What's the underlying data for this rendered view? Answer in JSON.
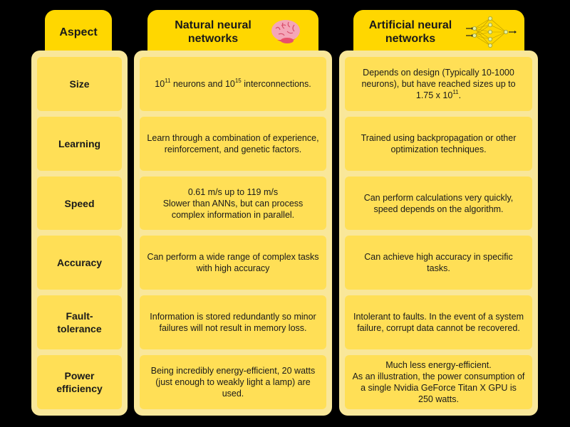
{
  "headers": {
    "aspect": "Aspect",
    "natural": "Natural neural networks",
    "artificial": "Artificial neural networks"
  },
  "icons": {
    "natural": "brain-icon",
    "artificial": "neural-network-icon"
  },
  "rows": [
    {
      "aspect": "Size",
      "natural": {
        "base1": "10",
        "exp1": "11",
        "mid": " neurons and ",
        "base2": "10",
        "exp2": "15",
        "tail": " interconnections."
      },
      "artificial": {
        "text": "Depends on design (Typically 10-1000 neurons), but have reached sizes up to 1.75 x 10",
        "exp": "11",
        "tail": "."
      }
    },
    {
      "aspect": "Learning",
      "natural": "Learn through a combination of experience, reinforcement, and genetic factors.",
      "artificial": "Trained using backpropagation or other optimization techniques."
    },
    {
      "aspect": "Speed",
      "natural_line1": "0.61 m/s up to 119 m/s",
      "natural_line2": "Slower than ANNs, but can process complex information in parallel.",
      "artificial": "Can perform calculations very quickly, speed depends on the algorithm."
    },
    {
      "aspect": "Accuracy",
      "natural": "Can perform a wide range of complex tasks with high accuracy",
      "artificial": "Can achieve high accuracy in specific tasks."
    },
    {
      "aspect_line1": "Fault-",
      "aspect_line2": "tolerance",
      "natural": "Information is stored redundantly so minor failures will not result in memory loss.",
      "artificial": "Intolerant to faults. In the event of a system failure, corrupt data cannot be recovered."
    },
    {
      "aspect_line1": "Power",
      "aspect_line2": "efficiency",
      "natural": "Being incredibly energy-efficient, 20 watts (just enough to weakly light a lamp) are used.",
      "artificial_line1": "Much less energy-efficient.",
      "artificial_line2": "As an illustration, the power consumption of a single Nvidia GeForce Titan X GPU is 250 watts."
    }
  ]
}
